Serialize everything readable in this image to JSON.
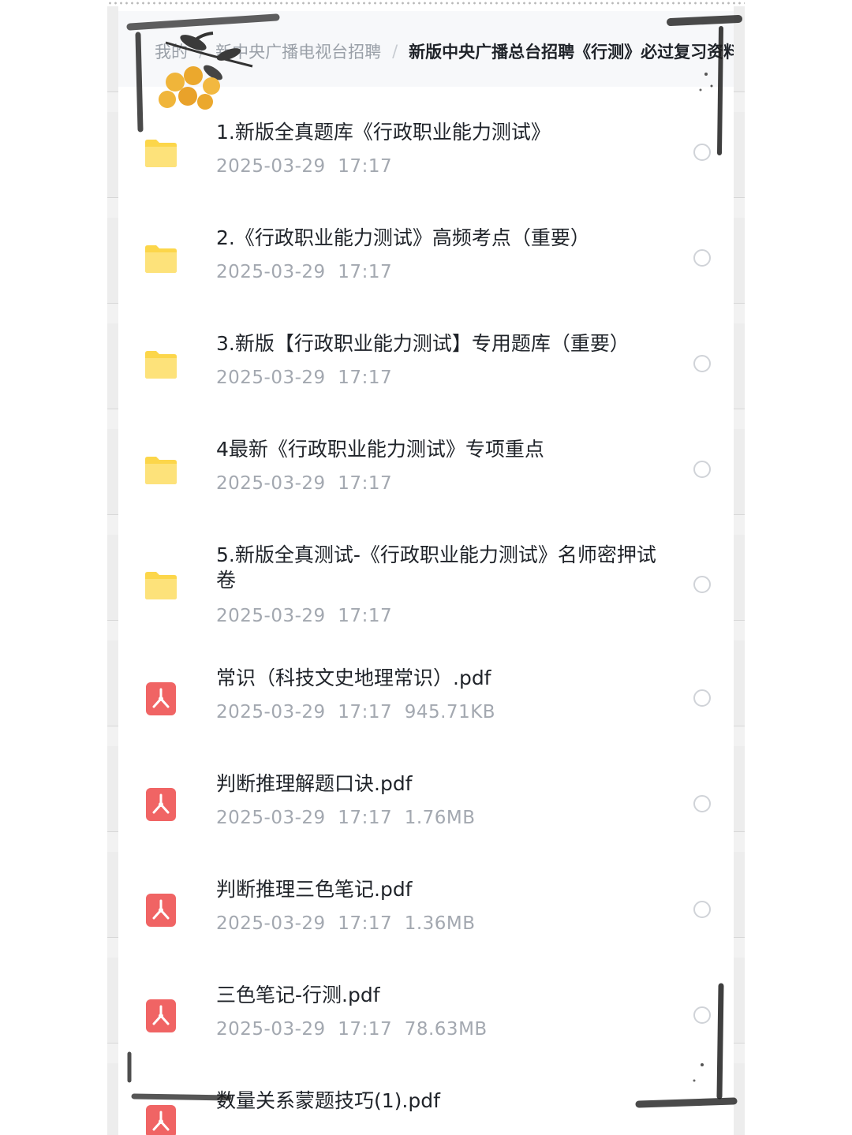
{
  "breadcrumb": {
    "items": [
      {
        "label": "我的"
      },
      {
        "label": "新中央广播电视台招聘"
      },
      {
        "label": "新版中央广播总台招聘《行测》必过复习资料"
      }
    ],
    "separator": "/"
  },
  "files": [
    {
      "name": "1.新版全真题库《行政职业能力测试》",
      "date": "2025-03-29",
      "time": "17:17",
      "size": "",
      "type": "folder"
    },
    {
      "name": "2.《行政职业能力测试》高频考点（重要）",
      "date": "2025-03-29",
      "time": "17:17",
      "size": "",
      "type": "folder"
    },
    {
      "name": "3.新版【行政职业能力测试】专用题库（重要）",
      "date": "2025-03-29",
      "time": "17:17",
      "size": "",
      "type": "folder"
    },
    {
      "name": "4最新《行政职业能力测试》专项重点",
      "date": "2025-03-29",
      "time": "17:17",
      "size": "",
      "type": "folder"
    },
    {
      "name": "5.新版全真测试-《行政职业能力测试》名师密押试卷",
      "date": "2025-03-29",
      "time": "17:17",
      "size": "",
      "type": "folder"
    },
    {
      "name": "常识（科技文史地理常识）.pdf",
      "date": "2025-03-29",
      "time": "17:17",
      "size": "945.71KB",
      "type": "pdf"
    },
    {
      "name": "判断推理解题口诀.pdf",
      "date": "2025-03-29",
      "time": "17:17",
      "size": "1.76MB",
      "type": "pdf"
    },
    {
      "name": "判断推理三色笔记.pdf",
      "date": "2025-03-29",
      "time": "17:17",
      "size": "1.36MB",
      "type": "pdf"
    },
    {
      "name": "三色笔记-行测.pdf",
      "date": "2025-03-29",
      "time": "17:17",
      "size": "78.63MB",
      "type": "pdf"
    },
    {
      "name": "数量关系蒙题技巧(1).pdf",
      "date": "",
      "time": "",
      "size": "",
      "type": "pdf"
    }
  ],
  "colors": {
    "folder": "#fcd64a",
    "pdf": "#f06464",
    "accent": "#2f7cf6",
    "text_primary": "#1f2329",
    "text_secondary": "#a3a8b0"
  },
  "icons": {
    "folder": "folder-icon",
    "pdf": "pdf-icon",
    "select": "select-circle"
  }
}
